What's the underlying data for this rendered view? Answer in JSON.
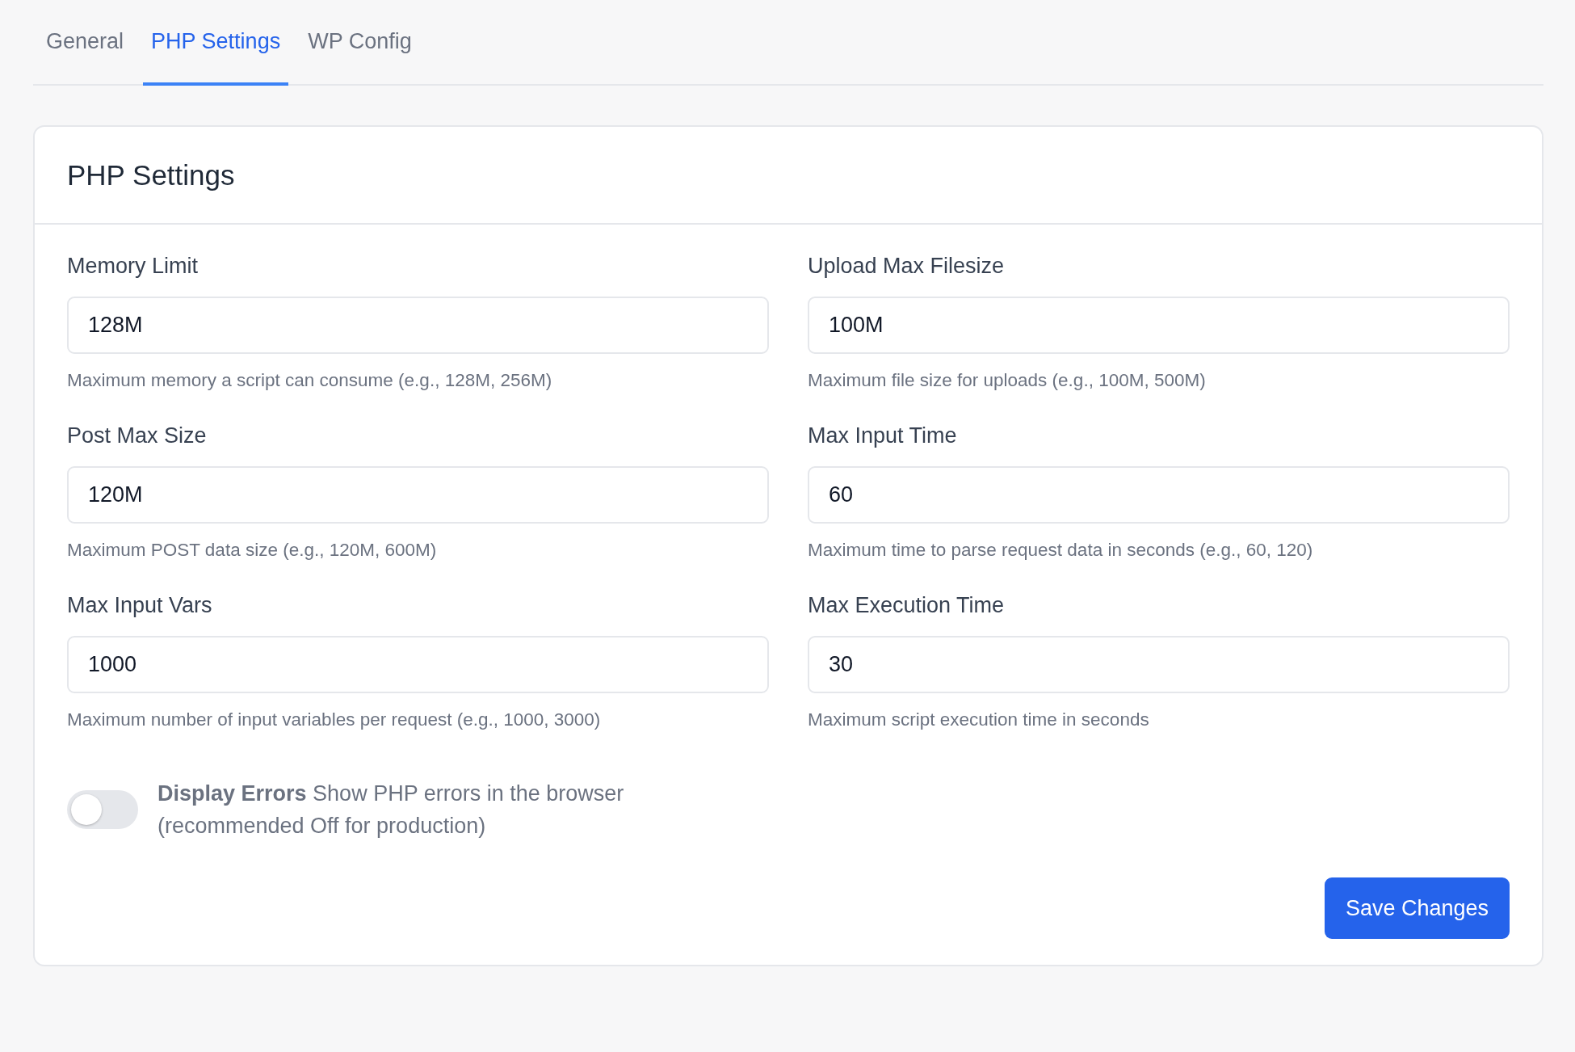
{
  "tabs": [
    {
      "label": "General",
      "selected": false
    },
    {
      "label": "PHP Settings",
      "selected": true
    },
    {
      "label": "WP Config",
      "selected": false
    }
  ],
  "panel": {
    "title": "PHP Settings",
    "fields": [
      {
        "label": "Memory Limit",
        "value": "128M",
        "help": "Maximum memory a script can consume (e.g., 128M, 256M)"
      },
      {
        "label": "Upload Max Filesize",
        "value": "100M",
        "help": "Maximum file size for uploads (e.g., 100M, 500M)"
      },
      {
        "label": "Post Max Size",
        "value": "120M",
        "help": "Maximum POST data size (e.g., 120M, 600M)"
      },
      {
        "label": "Max Input Time",
        "value": "60",
        "help": "Maximum time to parse request data in seconds (e.g., 60, 120)"
      },
      {
        "label": "Max Input Vars",
        "value": "1000",
        "help": "Maximum number of input variables per request (e.g., 1000, 3000)"
      },
      {
        "label": "Max Execution Time",
        "value": "30",
        "help": "Maximum script execution time in seconds"
      }
    ],
    "toggle": {
      "text": "**Display Errors** Show PHP errors in the browser (recommended Off for production)",
      "on": false
    },
    "save_button": "Save Changes"
  }
}
